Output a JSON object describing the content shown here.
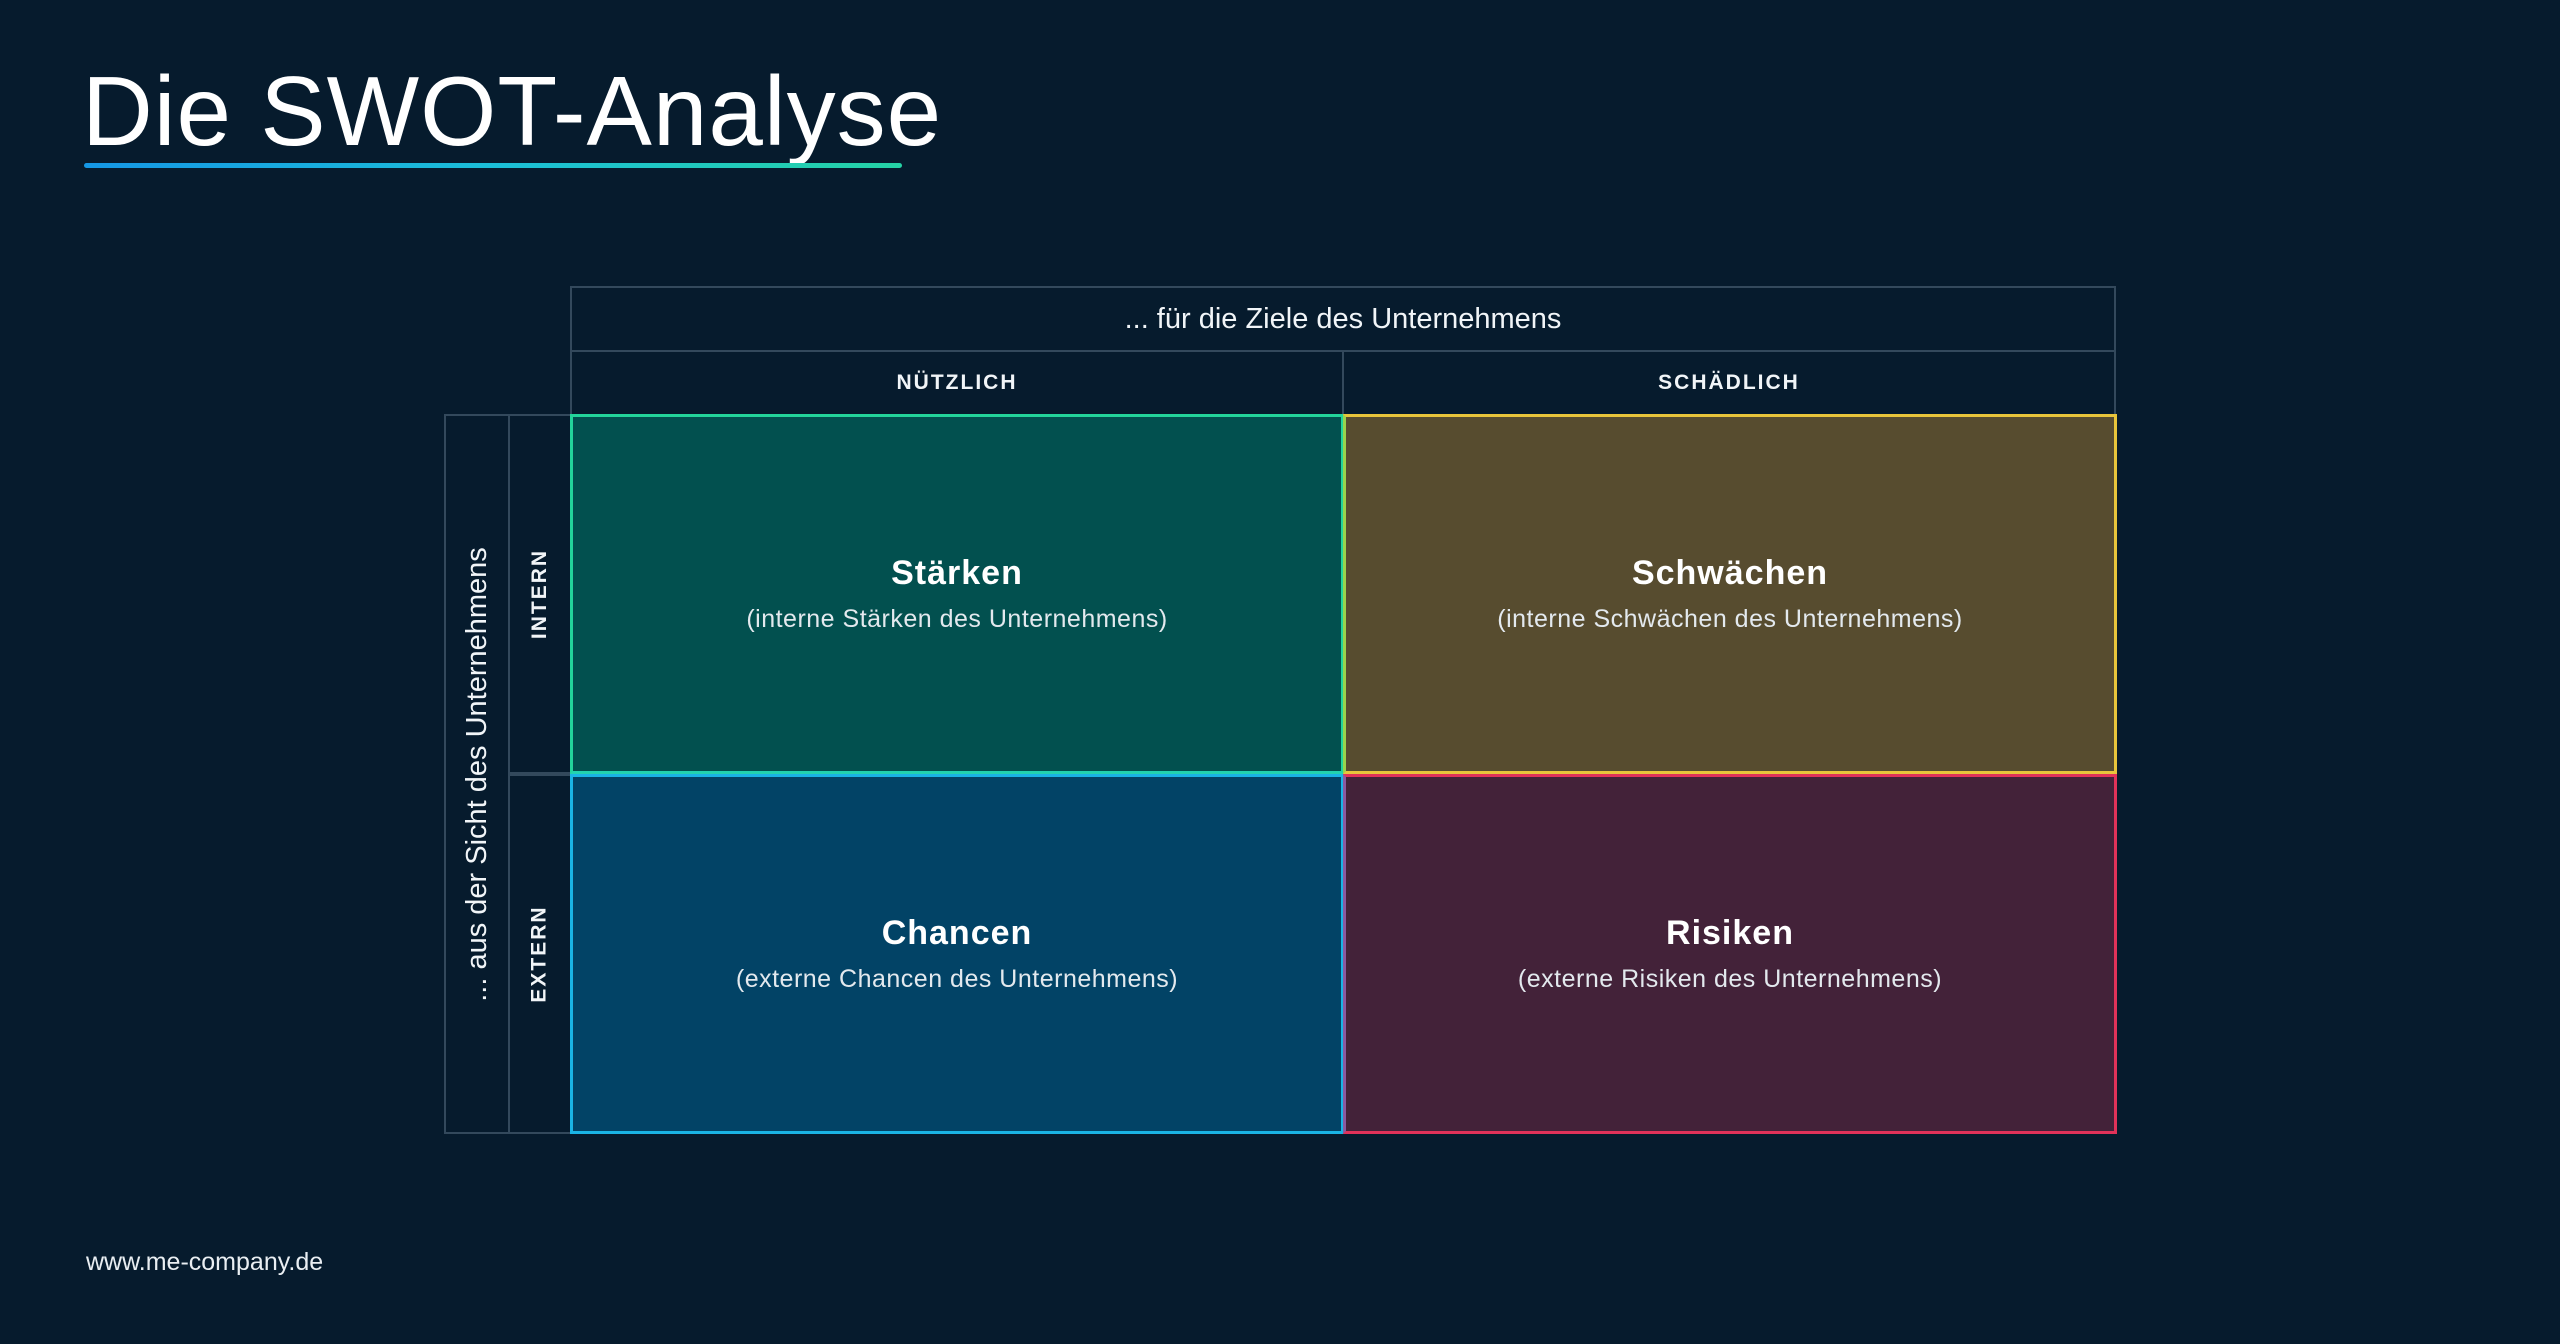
{
  "title": "Die SWOT-Analyse",
  "footer": {
    "url": "www.me-company.de"
  },
  "matrix": {
    "top_header": "... für die Ziele des Unternehmens",
    "columns": {
      "left": "NÜTZLICH",
      "right": "SCHÄDLICH"
    },
    "side_header": "... aus der Sicht des Unternehmens",
    "rows": {
      "top": "INTERN",
      "bottom": "EXTERN"
    },
    "quadrants": {
      "strengths": {
        "title": "Stärken",
        "subtitle": "(interne Stärken des Unternehmens)",
        "color": "#02504f",
        "border": "#23d49b"
      },
      "weaknesses": {
        "title": "Schwächen",
        "subtitle": "(interne Schwächen des Unternehmens)",
        "color": "#574c2f",
        "border": "#e8c53b"
      },
      "opportunities": {
        "title": "Chancen",
        "subtitle": "(externe Chancen des Unternehmens)",
        "color": "#024366",
        "border": "#1ab4e5"
      },
      "threats": {
        "title": "Risiken",
        "subtitle": "(externe Risiken des Unternehmens)",
        "color": "#432239",
        "border": "#e13259"
      }
    }
  },
  "colors": {
    "background": "#061b2d",
    "grid_line": "#33495c"
  }
}
